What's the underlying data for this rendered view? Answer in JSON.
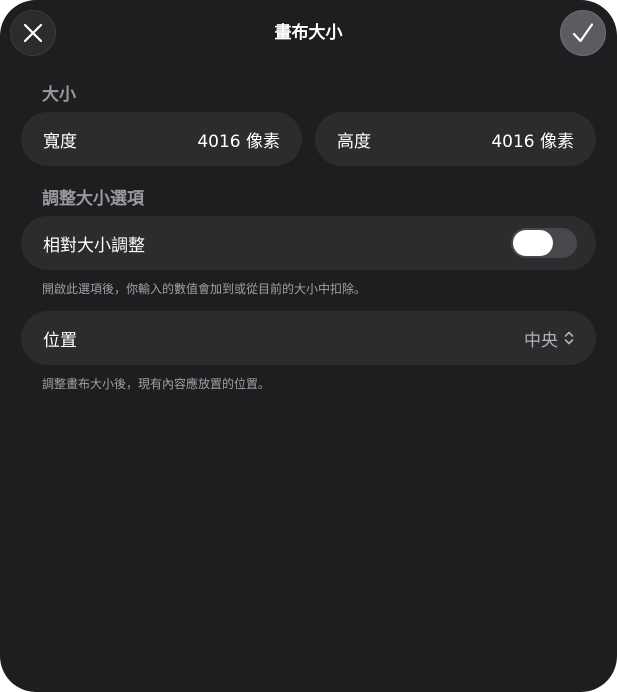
{
  "header": {
    "title": "畫布大小"
  },
  "size_section": {
    "label": "大小",
    "width": {
      "label": "寬度",
      "value": "4016 像素"
    },
    "height": {
      "label": "高度",
      "value": "4016 像素"
    }
  },
  "resize_options": {
    "label": "調整大小選項",
    "relative": {
      "label": "相對大小調整",
      "enabled": false,
      "hint": "開啟此選項後，你輸入的數值會加到或從目前的大小中扣除。"
    },
    "position": {
      "label": "位置",
      "value": "中央",
      "hint": "調整畫布大小後，現有內容應放置的位置。"
    }
  },
  "icons": {
    "close": "close-icon",
    "confirm": "checkmark-icon",
    "select": "chevron-up-down-icon"
  },
  "colors": {
    "background": "#1e1e20",
    "row": "#2c2c2e",
    "secondary_text": "#9a9a9e"
  }
}
